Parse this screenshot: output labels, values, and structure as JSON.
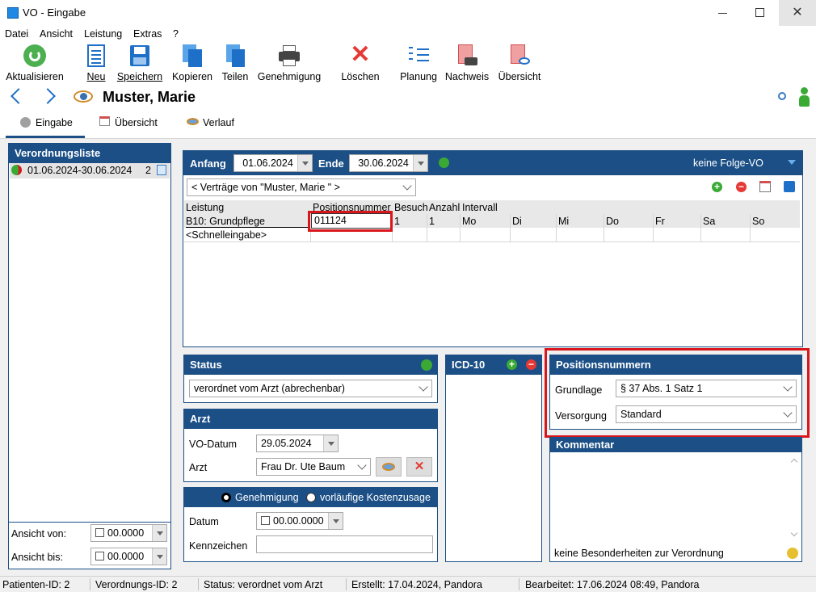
{
  "window": {
    "title": "VO - Eingabe"
  },
  "menu": [
    "Datei",
    "Ansicht",
    "Leistung",
    "Extras",
    "?"
  ],
  "toolbar": {
    "aktualisieren": "Aktualisieren",
    "neu": "Neu",
    "speichern": "Speichern",
    "kopieren": "Kopieren",
    "teilen": "Teilen",
    "genehmigung": "Genehmigung",
    "loeschen": "Löschen",
    "planung": "Planung",
    "nachweis": "Nachweis",
    "uebersicht": "Übersicht"
  },
  "patient": {
    "name": "Muster, Marie"
  },
  "tabs": [
    "Eingabe",
    "Übersicht",
    "Verlauf"
  ],
  "verordnungsliste": {
    "title": "Verordnungsliste",
    "items": [
      {
        "range": "01.06.2024-30.06.2024",
        "count": "2"
      }
    ],
    "ansicht_von_label": "Ansicht von:",
    "ansicht_von_value": "00.0000",
    "ansicht_bis_label": "Ansicht bis:",
    "ansicht_bis_value": "00.0000"
  },
  "period": {
    "anfang_label": "Anfang",
    "anfang": "01.06.2024",
    "ende_label": "Ende",
    "ende": "30.06.2024",
    "folge": "keine Folge-VO"
  },
  "vertraege": "< Verträge von \"Muster, Marie \" >",
  "table": {
    "headers": [
      "Leistung",
      "Positionsnummer",
      "Besuch",
      "Anzahl",
      "Intervall"
    ],
    "row": {
      "leistung": "B10: Grundpflege",
      "positionsnummer": "011124",
      "besuch": "1",
      "anzahl": "1",
      "days": [
        "Mo",
        "Di",
        "Mi",
        "Do",
        "Fr",
        "Sa",
        "So"
      ]
    },
    "schnelleingabe": "<Schnelleingabe>"
  },
  "status": {
    "title": "Status",
    "value": "verordnet vom Arzt (abrechenbar)"
  },
  "arzt": {
    "title": "Arzt",
    "vo_datum_label": "VO-Datum",
    "vo_datum": "29.05.2024",
    "arzt_label": "Arzt",
    "arzt_value": "Frau Dr. Ute Baum"
  },
  "genehmigung": {
    "option1": "Genehmigung",
    "option2": "vorläufige Kostenzusage",
    "datum_label": "Datum",
    "datum_value": "00.00.0000",
    "kennzeichen_label": "Kennzeichen",
    "kennzeichen_value": ""
  },
  "icd": {
    "title": "ICD-10"
  },
  "positionsnummern": {
    "title": "Positionsnummern",
    "grundlage_label": "Grundlage",
    "grundlage_value": "§ 37 Abs. 1 Satz 1",
    "versorgung_label": "Versorgung",
    "versorgung_value": "Standard"
  },
  "kommentar": {
    "title": "Kommentar",
    "footer": "keine Besonderheiten zur Verordnung"
  },
  "statusbar": {
    "patient_id": "Patienten-ID: 2",
    "vo_id": "Verordnungs-ID: 2",
    "status": "Status: verordnet vom Arzt",
    "erstellt": "Erstellt: 17.04.2024, Pandora",
    "bearbeitet": "Bearbeitet: 17.06.2024 08:49, Pandora"
  },
  "colors": {
    "accent": "#1b4f86",
    "highlight": "#d9161c",
    "ok": "#3aaa35"
  }
}
